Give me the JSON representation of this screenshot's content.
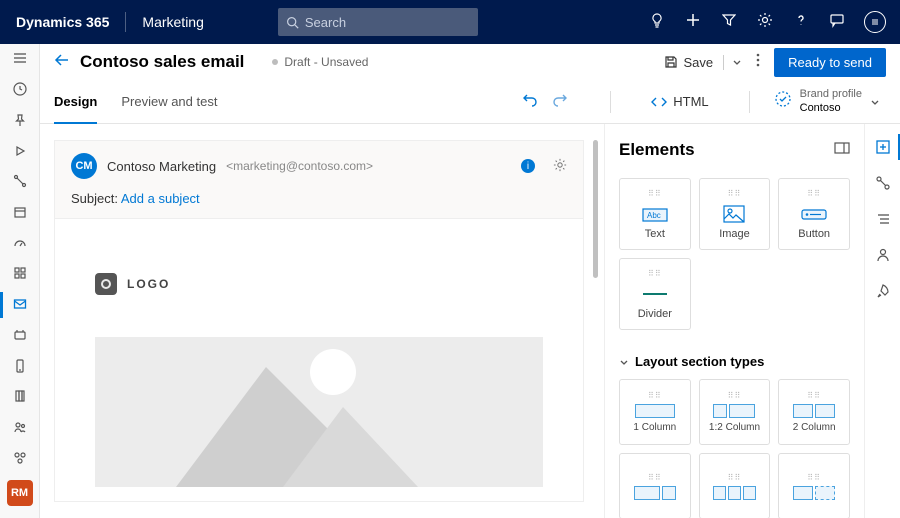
{
  "topnav": {
    "brand": "Dynamics 365",
    "module": "Marketing",
    "search_placeholder": "Search"
  },
  "titlebar": {
    "title": "Contoso sales email",
    "status": "Draft - Unsaved",
    "save_label": "Save",
    "ready_label": "Ready to send"
  },
  "tabs": {
    "design": "Design",
    "preview": "Preview and test",
    "html": "HTML",
    "brand_profile_label": "Brand profile",
    "brand_profile_value": "Contoso"
  },
  "email": {
    "from_initials": "CM",
    "from_name": "Contoso Marketing",
    "from_email": "<marketing@contoso.com>",
    "subject_label": "Subject:",
    "subject_add": "Add a subject",
    "logo_text": "LOGO"
  },
  "rightpanel": {
    "title": "Elements",
    "elements": {
      "text": "Text",
      "image": "Image",
      "button": "Button",
      "divider": "Divider"
    },
    "layout_title": "Layout section types",
    "layouts": {
      "c1": "1 Column",
      "c12": "1:2 Column",
      "c2": "2 Column"
    }
  },
  "avatar": "RM"
}
